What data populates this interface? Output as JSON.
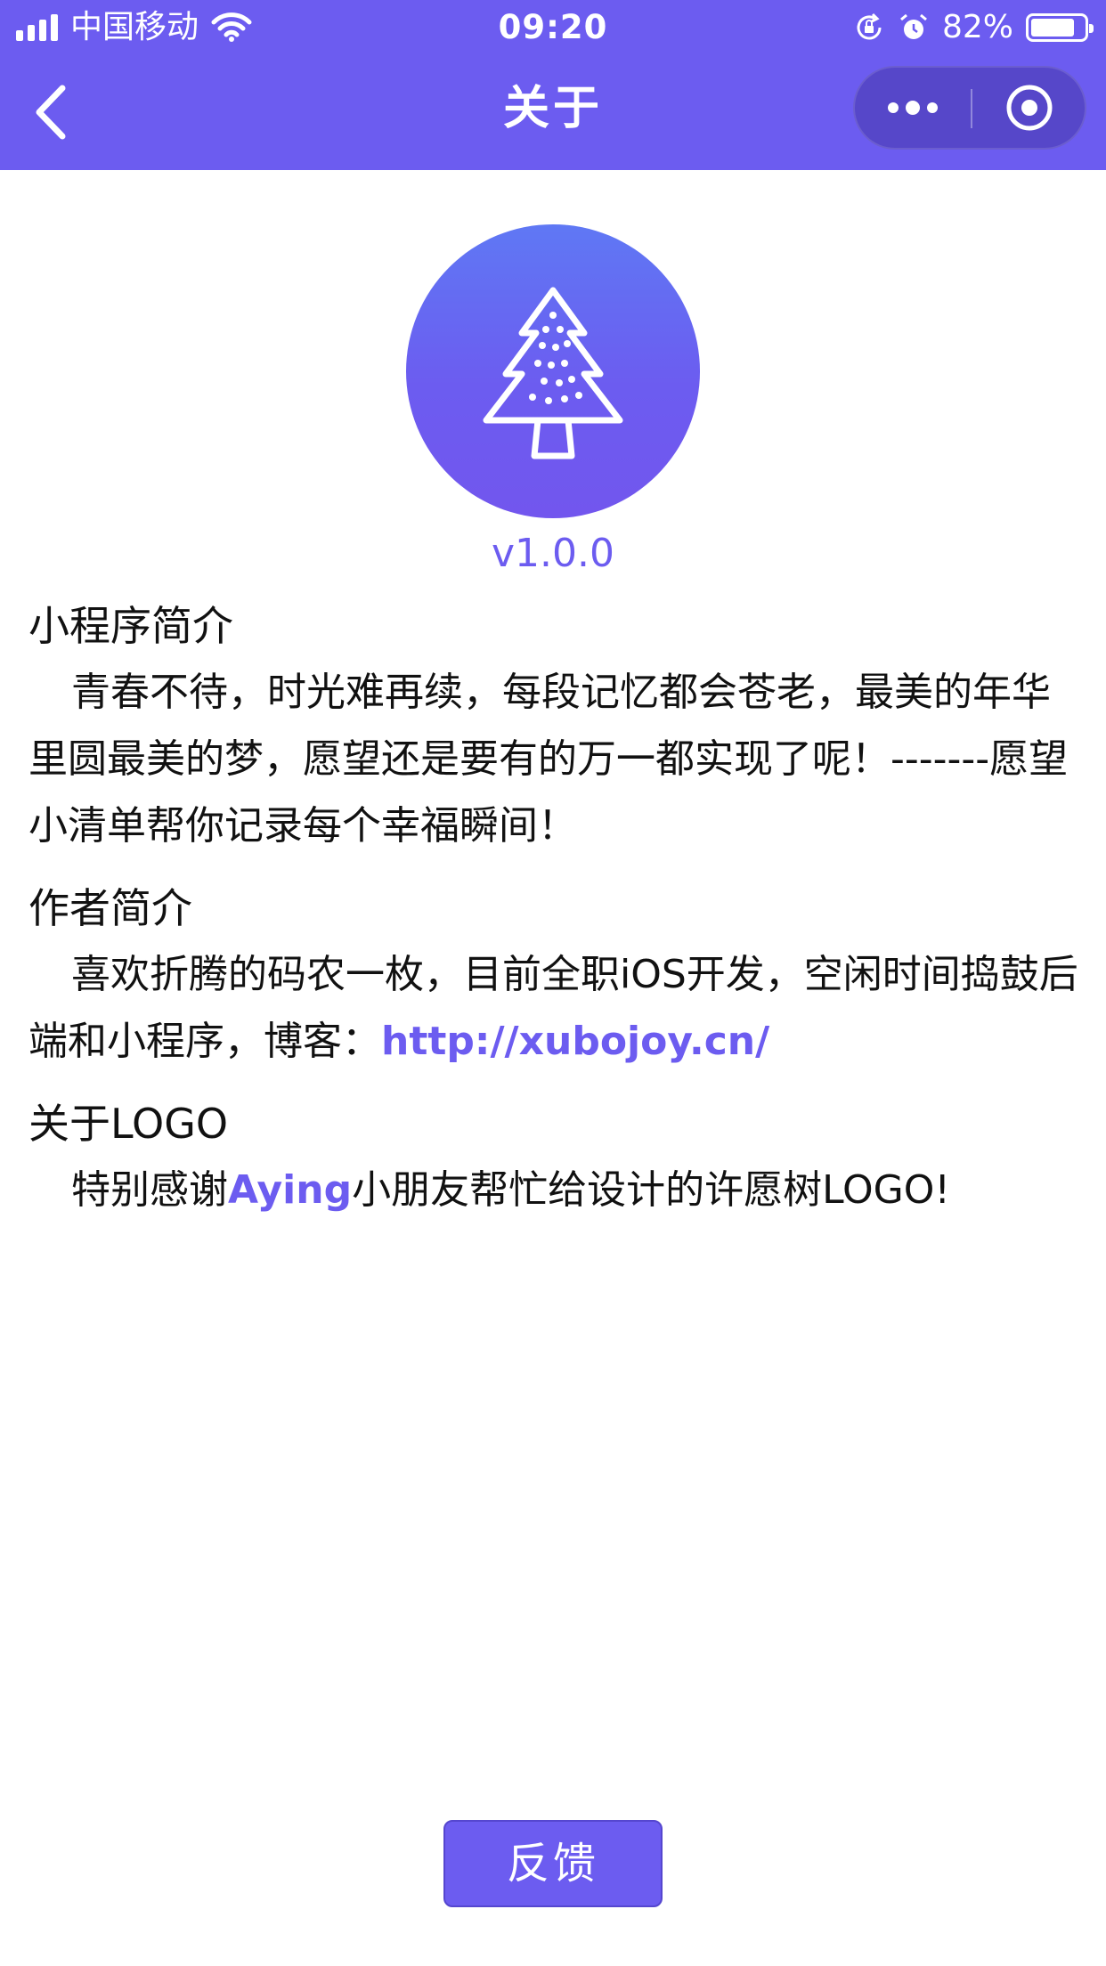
{
  "status_bar": {
    "carrier": "中国移动",
    "time": "09:20",
    "battery_percent_text": "82%",
    "battery_level": 0.82,
    "icons": [
      "signal-icon",
      "wifi-icon",
      "orientation-lock-icon",
      "alarm-icon",
      "battery-icon"
    ]
  },
  "nav": {
    "title": "关于",
    "back_icon": "chevron-left-icon",
    "more_icon": "more-dots-icon",
    "close_icon": "target-circle-icon"
  },
  "colors": {
    "accent": "#6c5cf0",
    "text": "#111111",
    "background": "#ffffff"
  },
  "app": {
    "logo_icon": "christmas-tree-icon",
    "version": "v1.0.0"
  },
  "sections": {
    "intro": {
      "title": "小程序简介",
      "text": "青春不待，时光难再续，每段记忆都会苍老，最美的年华里圆最美的梦，愿望还是要有的万一都实现了呢！-------愿望小清单帮你记录每个幸福瞬间！"
    },
    "author": {
      "title": "作者简介",
      "text": "喜欢折腾的码农一枚，目前全职iOS开发，空闲时间捣鼓后端和小程序，博客：",
      "link": "http://xubojoy.cn/"
    },
    "logo": {
      "title": "关于LOGO",
      "text_before": "特别感谢",
      "designer": "Aying",
      "text_after": "小朋友帮忙给设计的许愿树LOGO!"
    }
  },
  "feedback_button": "反馈"
}
